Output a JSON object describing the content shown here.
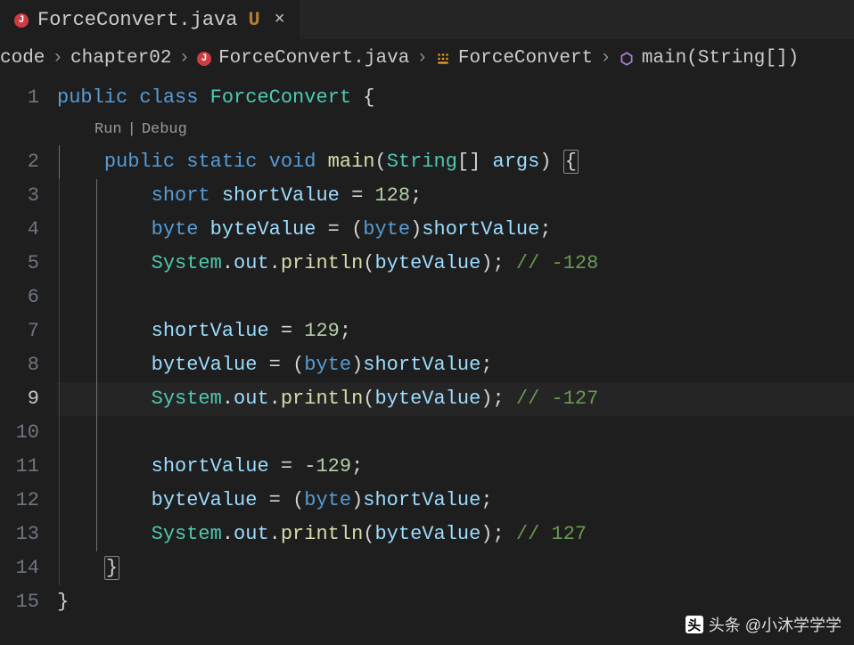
{
  "tab": {
    "filename": "ForceConvert.java",
    "modified_indicator": "U",
    "close_glyph": "×"
  },
  "breadcrumb": {
    "items": [
      "code",
      "chapter02",
      "ForceConvert.java",
      "ForceConvert",
      "main(String[])"
    ],
    "sep": "›"
  },
  "codelens": {
    "run": "Run",
    "debug": "Debug",
    "sep": "|"
  },
  "line_numbers": [
    "1",
    "2",
    "3",
    "4",
    "5",
    "6",
    "7",
    "8",
    "9",
    "10",
    "11",
    "12",
    "13",
    "14",
    "15"
  ],
  "active_line": "9",
  "code": {
    "l1": {
      "public": "public",
      "class": "class",
      "name": "ForceConvert",
      "ob": "{"
    },
    "l2": {
      "public": "public",
      "static": "static",
      "void": "void",
      "main": "main",
      "op": "(",
      "string": "String",
      "arr": "[]",
      "args": "args",
      "cp": ")",
      "ob": "{"
    },
    "l3": {
      "type": "short",
      "var": "shortValue",
      "eq": "=",
      "val": "128",
      "sc": ";"
    },
    "l4": {
      "type": "byte",
      "var": "byteValue",
      "eq": "=",
      "op": "(",
      "cast": "byte",
      "cp": ")",
      "src": "shortValue",
      "sc": ";"
    },
    "l5": {
      "sys": "System",
      "d1": ".",
      "out": "out",
      "d2": ".",
      "println": "println",
      "op": "(",
      "arg": "byteValue",
      "cp": ")",
      "sc": ";",
      "cm": "// -128"
    },
    "l7": {
      "var": "shortValue",
      "eq": "=",
      "val": "129",
      "sc": ";"
    },
    "l8": {
      "var": "byteValue",
      "eq": "=",
      "op": "(",
      "cast": "byte",
      "cp": ")",
      "src": "shortValue",
      "sc": ";"
    },
    "l9": {
      "sys": "System",
      "d1": ".",
      "out": "out",
      "d2": ".",
      "println": "println",
      "op": "(",
      "arg": "byteValue",
      "cp": ")",
      "sc": ";",
      "cm": "// -127"
    },
    "l11": {
      "var": "shortValue",
      "eq": "=",
      "minus": "-",
      "val": "129",
      "sc": ";"
    },
    "l12": {
      "var": "byteValue",
      "eq": "=",
      "op": "(",
      "cast": "byte",
      "cp": ")",
      "src": "shortValue",
      "sc": ";"
    },
    "l13": {
      "sys": "System",
      "d1": ".",
      "out": "out",
      "d2": ".",
      "println": "println",
      "op": "(",
      "arg": "byteValue",
      "cp": ")",
      "sc": ";",
      "cm": "// 127"
    },
    "l14": {
      "cb": "}"
    },
    "l15": {
      "cb": "}"
    }
  },
  "watermark": {
    "logo": "头",
    "text": "头条 @小沐学学学"
  }
}
